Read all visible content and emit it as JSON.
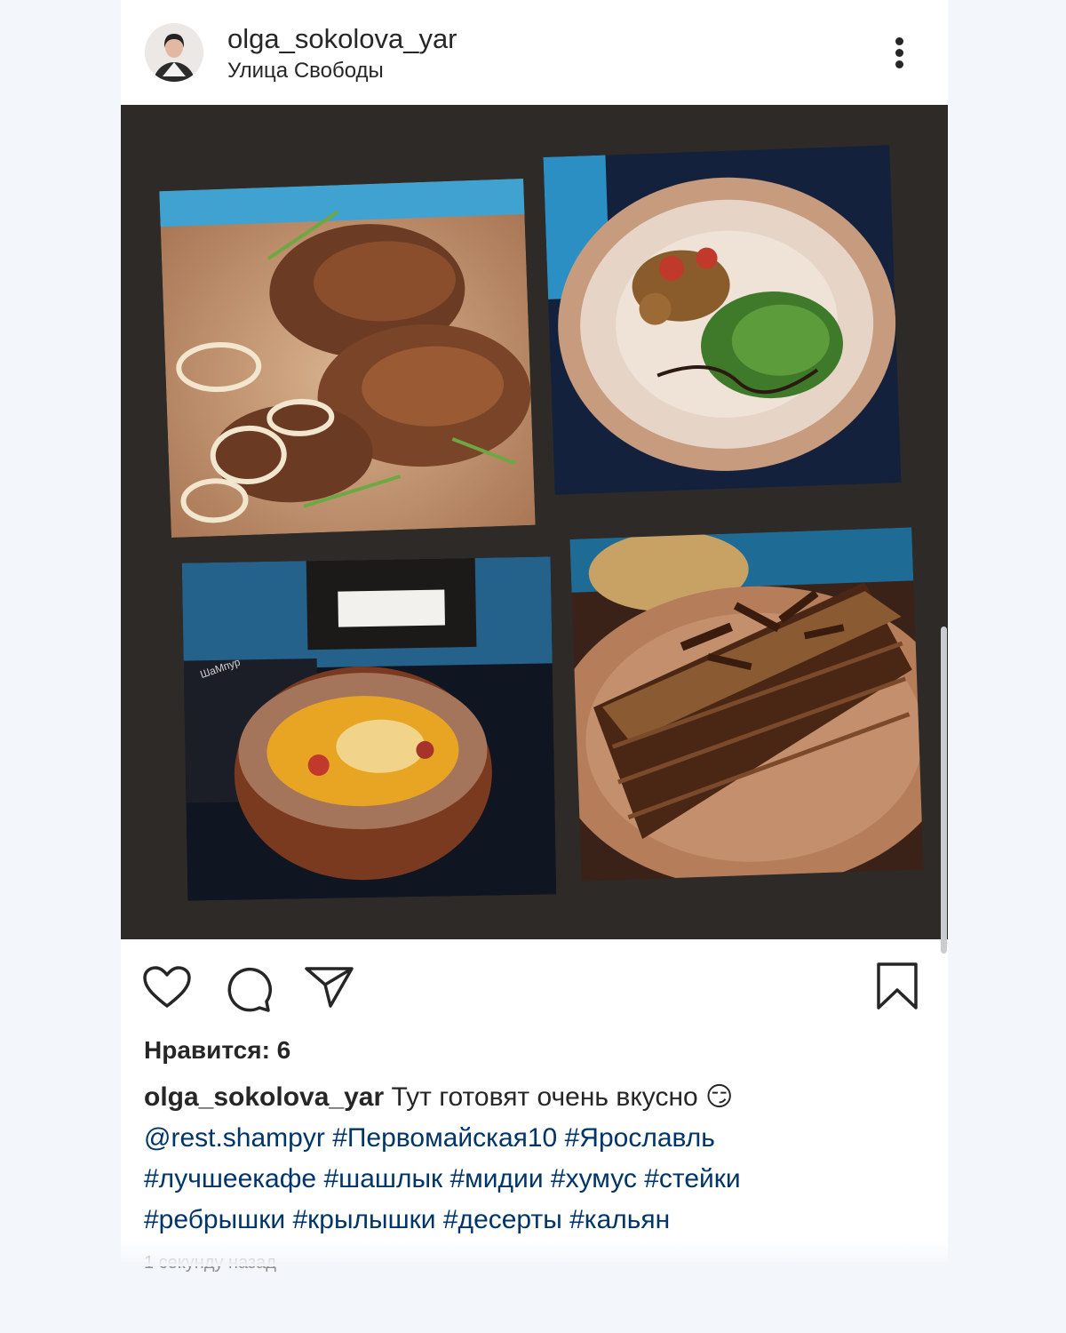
{
  "post": {
    "username": "olga_sokolova_yar",
    "location": "Улица Свободы",
    "likes_label": "Нравится: 6",
    "caption": {
      "username": "olga_sokolova_yar",
      "text": " Тут готовят очень вкусно ",
      "emoji": "😏",
      "mention": "@rest.shampyr",
      "hashtags": [
        "#Первомайская10",
        "#Ярославль",
        "#лучшеекафе",
        "#шашлык",
        "#мидии",
        "#хумус",
        "#стейки",
        "#ребрышки",
        "#крылышки",
        "#десерты",
        "#кальян"
      ]
    },
    "timestamp": "1 секунду назад",
    "menu_book_label": "ШаМпур"
  },
  "icons": {
    "more": "more-options-icon",
    "like": "heart-icon",
    "comment": "comment-icon",
    "share": "send-icon",
    "save": "bookmark-icon"
  },
  "colors": {
    "text": "#262626",
    "link": "#003569",
    "muted": "#8e8e8e",
    "photo_background": "#2e2a27"
  }
}
